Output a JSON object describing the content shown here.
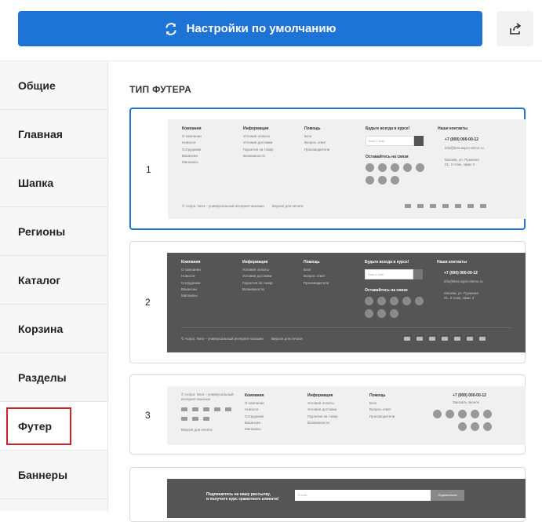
{
  "header": {
    "reset_label": "Настройки по умолчанию"
  },
  "sidebar": {
    "items": [
      {
        "label": "Общие"
      },
      {
        "label": "Главная"
      },
      {
        "label": "Шапка"
      },
      {
        "label": "Регионы"
      },
      {
        "label": "Каталог"
      },
      {
        "label": "Корзина"
      },
      {
        "label": "Разделы"
      },
      {
        "label": "Футер"
      },
      {
        "label": "Баннеры"
      }
    ]
  },
  "main": {
    "section_title": "ТИП ФУТЕРА",
    "options": [
      {
        "number": "1"
      },
      {
        "number": "2"
      },
      {
        "number": "3"
      }
    ]
  },
  "footer_preview": {
    "company_title": "Компания",
    "company_items": [
      "О компании",
      "Новости",
      "Сотрудники",
      "Вакансии",
      "Магазины"
    ],
    "info_title": "Информация",
    "info_items": [
      "Условия оплаты",
      "Условия доставки",
      "Гарантия на товар",
      "Возможности"
    ],
    "help_title": "Помощь",
    "help_items": [
      "Блог",
      "Вопрос ответ",
      "Производители"
    ],
    "subscribe_title": "Будьте всегда в курсе!",
    "email_placeholder": "Ваш e-mail",
    "social_title": "Оставайтесь на связи",
    "contacts_title": "Наши контакты",
    "phone": "+7 (000) 000-00-12",
    "email": "info@test.aspro-demo.ru",
    "address_line1": "Москва, ул. Пушкина",
    "address_line2": "21, 3 этаж, офис 4",
    "copyright": "© Аспро: Next – универсальный интернет-магазин",
    "copyright_short_1": "© Аспро: Next – универсальный",
    "copyright_short_2": "интернет-магазин",
    "accessibility": "Версия для печати",
    "callback": "Заказать звонок"
  },
  "subscribe_banner": {
    "line1": "Подпишитесь на нашу рассылку,",
    "line2": "и получите курс грамотного клиента!",
    "placeholder": "E-mail",
    "button": "Подписаться"
  },
  "colors": {
    "accent": "#1e73d6",
    "active_border": "#d0202a"
  }
}
